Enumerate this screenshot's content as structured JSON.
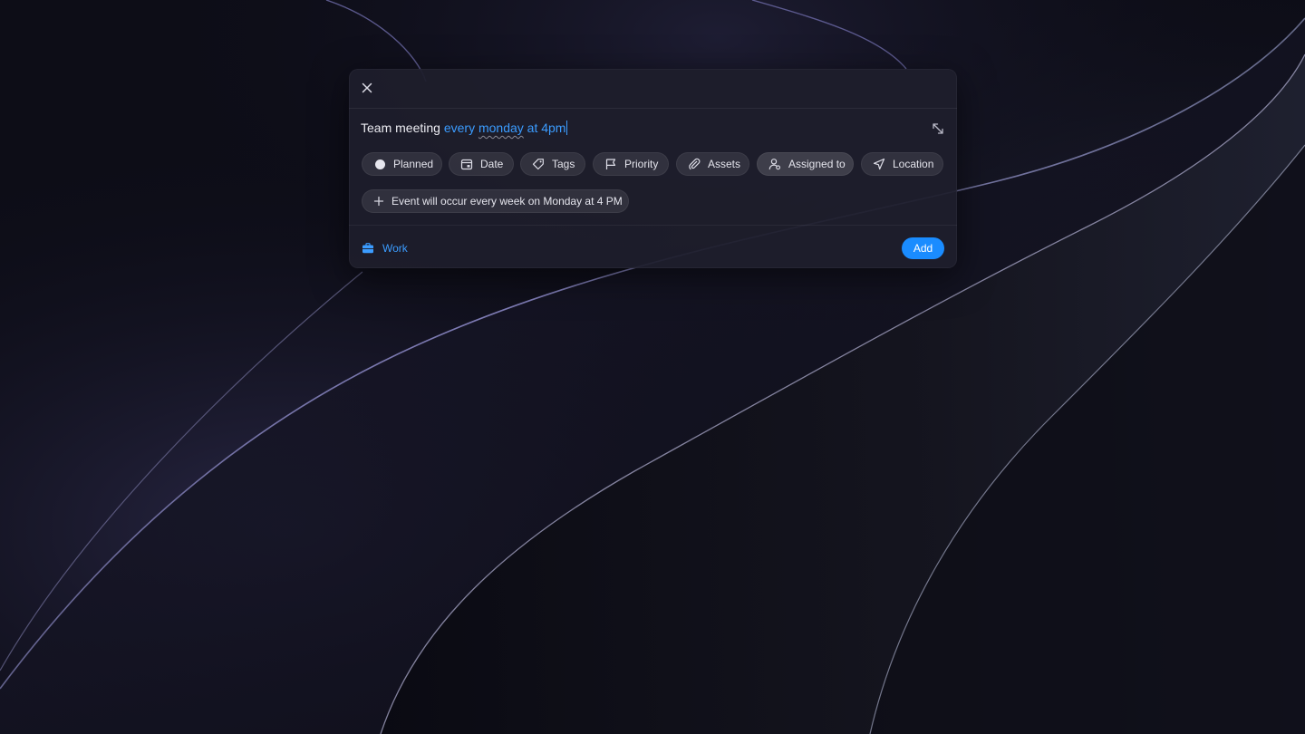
{
  "dialog": {
    "close_icon": "close-icon",
    "expand_icon": "expand-icon",
    "title_input": {
      "plain_text": "Team meeting ",
      "parsed_part1": "every ",
      "parsed_part2": "monday",
      "parsed_part3": " at 4pm"
    },
    "chips": [
      {
        "label": "Planned",
        "icon": "status-dot-icon"
      },
      {
        "label": "Date",
        "icon": "calendar-icon"
      },
      {
        "label": "Tags",
        "icon": "tag-icon"
      },
      {
        "label": "Priority",
        "icon": "flag-icon"
      },
      {
        "label": "Assets",
        "icon": "paperclip-icon"
      },
      {
        "label": "Assigned to",
        "icon": "user-icon"
      },
      {
        "label": "Location",
        "icon": "location-arrow-icon"
      }
    ],
    "recurrence": {
      "label": "Event will occur every week on Monday at 4 PM",
      "icon": "plus-icon"
    },
    "footer": {
      "project_label": "Work",
      "project_icon": "briefcase-icon",
      "add_label": "Add"
    }
  },
  "colors": {
    "accent": "#1a8cff",
    "parsed_text": "#3b9cff",
    "dialog_bg": "#1e1e2c"
  }
}
